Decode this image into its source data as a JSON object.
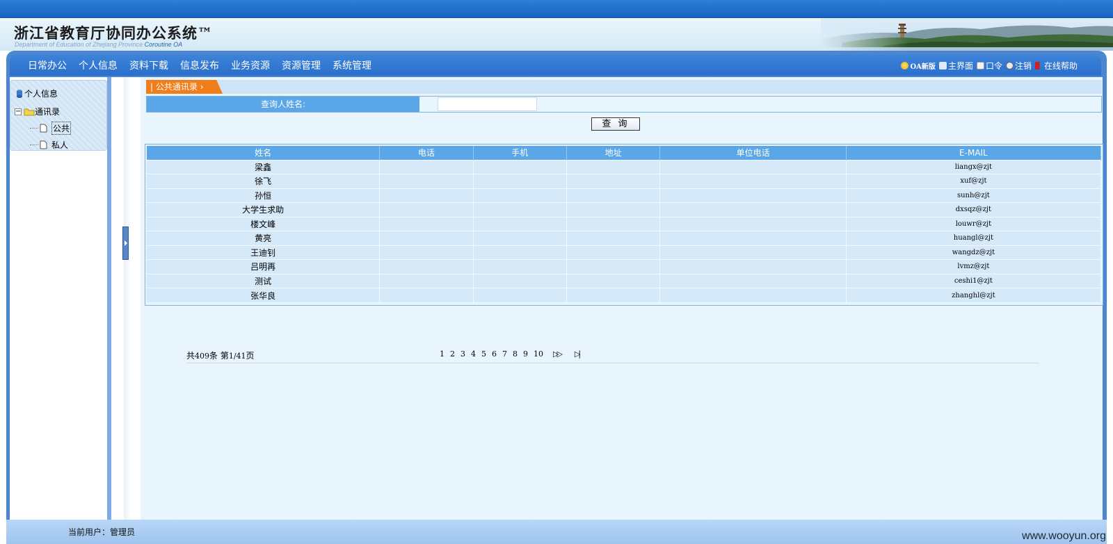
{
  "header": {
    "title": "浙江省教育厅协同办公系统",
    "tm": "™",
    "subtitle_prefix": "Department of Education of Zhejiang Province",
    "subtitle_suffix": "Coroutine OA"
  },
  "nav": {
    "menu": [
      "日常办公",
      "个人信息",
      "资料下载",
      "信息发布",
      "业务资源",
      "资源管理",
      "系统管理"
    ],
    "right": {
      "oa_new": "OA新版",
      "home": "主界面",
      "password": "口令",
      "logout": "注销",
      "help": "在线帮助"
    }
  },
  "tree": {
    "root": "个人信息",
    "folder": "通讯录",
    "children": [
      "公共",
      "私人"
    ]
  },
  "tab": {
    "label": "公共通讯录"
  },
  "search": {
    "label": "查询人姓名:",
    "value": "",
    "button": "查 询"
  },
  "table": {
    "headers": [
      "姓名",
      "电话",
      "手机",
      "地址",
      "单位电话",
      "E-MAIL"
    ],
    "rows": [
      [
        "梁鑫",
        "",
        "",
        "",
        "",
        "liangx@zjt"
      ],
      [
        "徐飞",
        "",
        "",
        "",
        "",
        "xuf@zjt"
      ],
      [
        "孙恒",
        "",
        "",
        "",
        "",
        "sunh@zjt"
      ],
      [
        "大学生求助",
        "",
        "",
        "",
        "",
        "dxsqz@zjt"
      ],
      [
        "楼文峰",
        "",
        "",
        "",
        "",
        "louwr@zjt"
      ],
      [
        "黄亮",
        "",
        "",
        "",
        "",
        "huangl@zjt"
      ],
      [
        "王迪钊",
        "",
        "",
        "",
        "",
        "wangdz@zjt"
      ],
      [
        "吕明再",
        "",
        "",
        "",
        "",
        "lvmz@zjt"
      ],
      [
        "测试",
        "",
        "",
        "",
        "",
        "ceshi1@zjt"
      ],
      [
        "张华良",
        "",
        "",
        "",
        "",
        "zhanghl@zjt"
      ]
    ]
  },
  "pager": {
    "total_prefix": "共",
    "total": "409",
    "total_suffix": "条 第",
    "page": "1/41",
    "page_suffix": "页",
    "pages": [
      "1",
      "2",
      "3",
      "4",
      "5",
      "6",
      "7",
      "8",
      "9",
      "10"
    ],
    "next": "▷▷",
    "last": "▷|"
  },
  "status": {
    "user": "当前用户：管理员"
  },
  "watermark": "www.wooyun.org",
  "colors": {
    "accent": "#2a6fcc",
    "tab": "#f07e1b",
    "header_cell": "#5aa6e6",
    "row": "#d6e9f8"
  }
}
